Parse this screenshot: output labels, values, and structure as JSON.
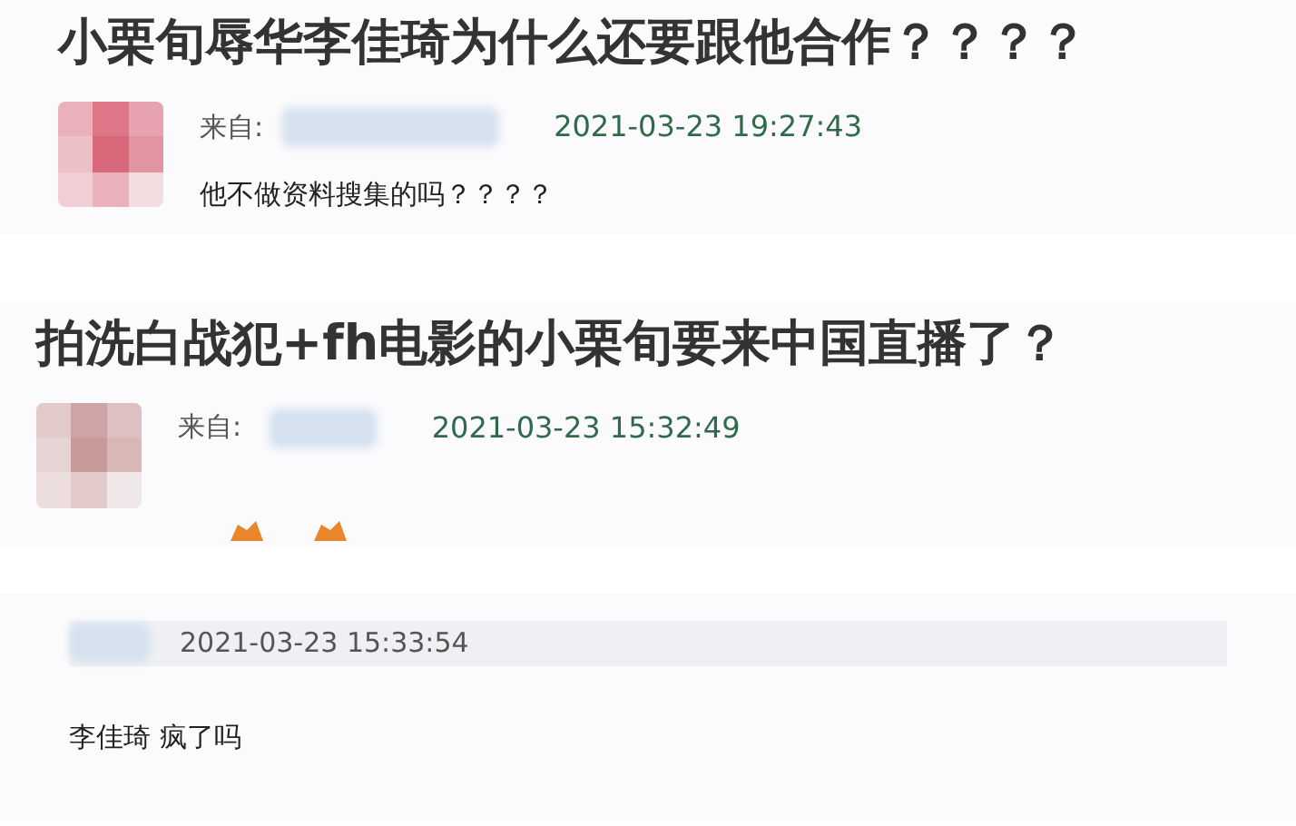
{
  "posts": [
    {
      "kind": "post",
      "title": "小栗旬辱华李佳琦为什么还要跟他合作？？？？",
      "from_label": "来自:",
      "time": "2021-03-23 19:27:43",
      "body": "他不做资料搜集的吗？？？？",
      "emoji": false
    },
    {
      "kind": "post",
      "title": "拍洗白战犯+fh电影的小栗旬要来中国直播了？",
      "from_label": "来自: ",
      "time": "2021-03-23 15:32:49",
      "emoji": true
    },
    {
      "kind": "reply",
      "time": "2021-03-23 15:33:54",
      "body": "李佳琦 疯了吗"
    }
  ]
}
